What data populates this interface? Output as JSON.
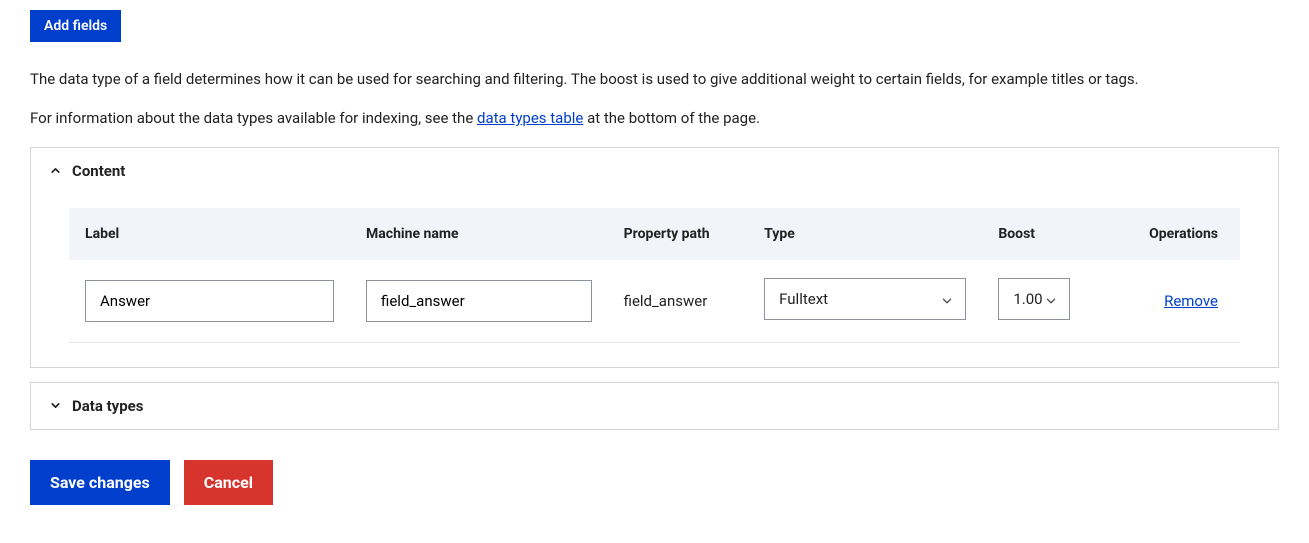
{
  "buttons": {
    "add_fields": "Add fields",
    "save": "Save changes",
    "cancel": "Cancel"
  },
  "intro": {
    "line1": "The data type of a field determines how it can be used for searching and filtering. The boost is used to give additional weight to certain fields, for example titles or tags.",
    "line2_prefix": "For information about the data types available for indexing, see the ",
    "line2_link": "data types table",
    "line2_suffix": " at the bottom of the page."
  },
  "panels": {
    "content_title": "Content",
    "data_types_title": "Data types"
  },
  "table": {
    "headers": {
      "label": "Label",
      "machine_name": "Machine name",
      "property_path": "Property path",
      "type": "Type",
      "boost": "Boost",
      "operations": "Operations"
    },
    "rows": [
      {
        "label": "Answer",
        "machine_name": "field_answer",
        "property_path": "field_answer",
        "type": "Fulltext",
        "boost": "1.00",
        "remove": "Remove"
      }
    ]
  }
}
